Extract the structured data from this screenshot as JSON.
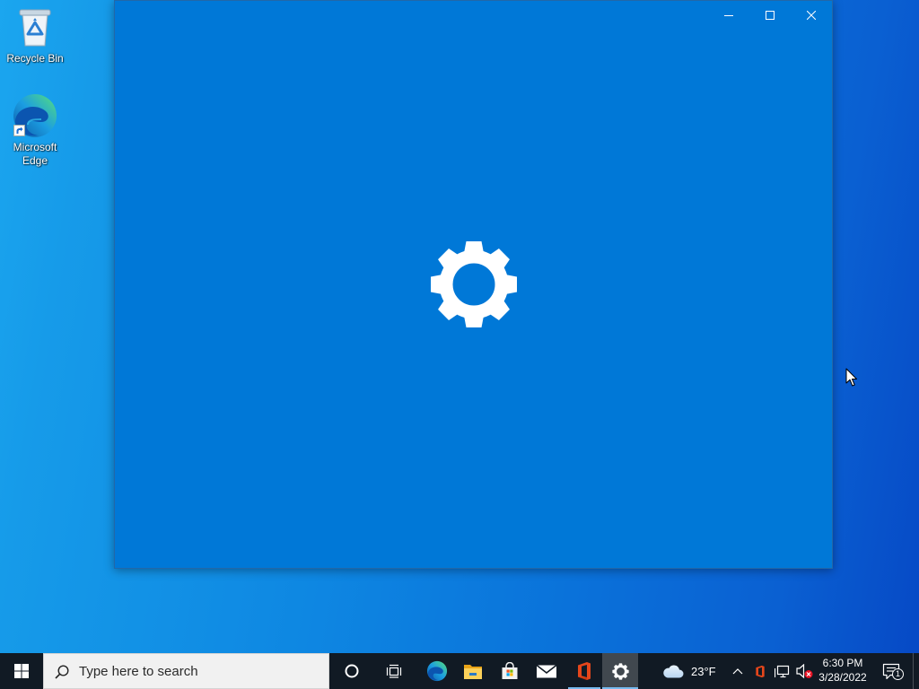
{
  "desktop": {
    "icons": [
      {
        "label": "Recycle Bin",
        "icon": "recycle-bin-icon"
      },
      {
        "label": "Microsoft Edge",
        "icon": "microsoft-edge-icon",
        "shortcut": true
      }
    ]
  },
  "window": {
    "background": "#0078d7",
    "splash_icon": "gear-icon",
    "controls": [
      {
        "icon": "minimize-icon"
      },
      {
        "icon": "maximize-icon"
      },
      {
        "icon": "close-icon"
      }
    ]
  },
  "taskbar": {
    "background": "#111a24",
    "start": {
      "icon": "windows-logo-icon"
    },
    "search": {
      "icon": "search-icon",
      "placeholder": "Type here to search"
    },
    "buttons": [
      {
        "icon": "cortana-icon"
      },
      {
        "icon": "task-view-icon"
      }
    ],
    "pinned_apps": [
      {
        "icon": "edge-icon",
        "running": false,
        "active": false
      },
      {
        "icon": "file-explorer-icon",
        "running": false,
        "active": false
      },
      {
        "icon": "microsoft-store-icon",
        "running": false,
        "active": false
      },
      {
        "icon": "mail-icon",
        "running": false,
        "active": false
      },
      {
        "icon": "office-icon",
        "running": true,
        "active": false
      },
      {
        "icon": "settings-icon",
        "running": true,
        "active": true
      }
    ],
    "weather": {
      "icon": "cloud-icon",
      "temperature": "23°F"
    },
    "tray": [
      {
        "icon": "chevron-up-icon"
      },
      {
        "icon": "office-tray-icon"
      },
      {
        "icon": "network-icon"
      },
      {
        "icon": "volume-muted-icon"
      }
    ],
    "clock": {
      "time": "6:30 PM",
      "date": "3/28/2022"
    },
    "notifications": {
      "icon": "action-center-icon",
      "count": "1"
    }
  },
  "cursor": {
    "icon": "mouse-pointer-icon"
  }
}
